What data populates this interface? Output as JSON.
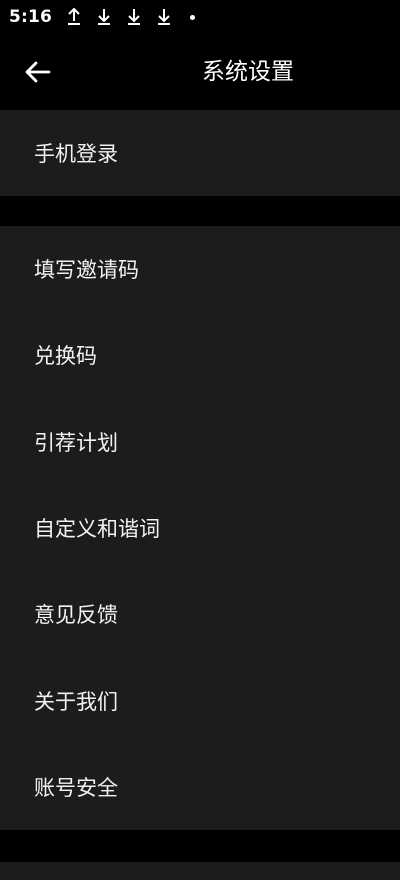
{
  "status_bar": {
    "time": "5:16",
    "icons": [
      "upload-arrow-icon",
      "download-arrow-icon",
      "download-arrow-icon",
      "download-arrow-icon",
      "notification-dot-icon"
    ]
  },
  "header": {
    "back_icon": "back-arrow-icon",
    "title": "系统设置"
  },
  "sections": [
    {
      "items": [
        {
          "label": "手机登录"
        }
      ]
    },
    {
      "items": [
        {
          "label": "填写邀请码"
        },
        {
          "label": "兑换码"
        },
        {
          "label": "引荐计划"
        },
        {
          "label": "自定义和谐词"
        },
        {
          "label": "意见反馈"
        },
        {
          "label": "关于我们"
        },
        {
          "label": "账号安全"
        }
      ]
    }
  ],
  "colors": {
    "background": "#000000",
    "row_background": "#1c1c1c",
    "text": "#ffffff"
  }
}
